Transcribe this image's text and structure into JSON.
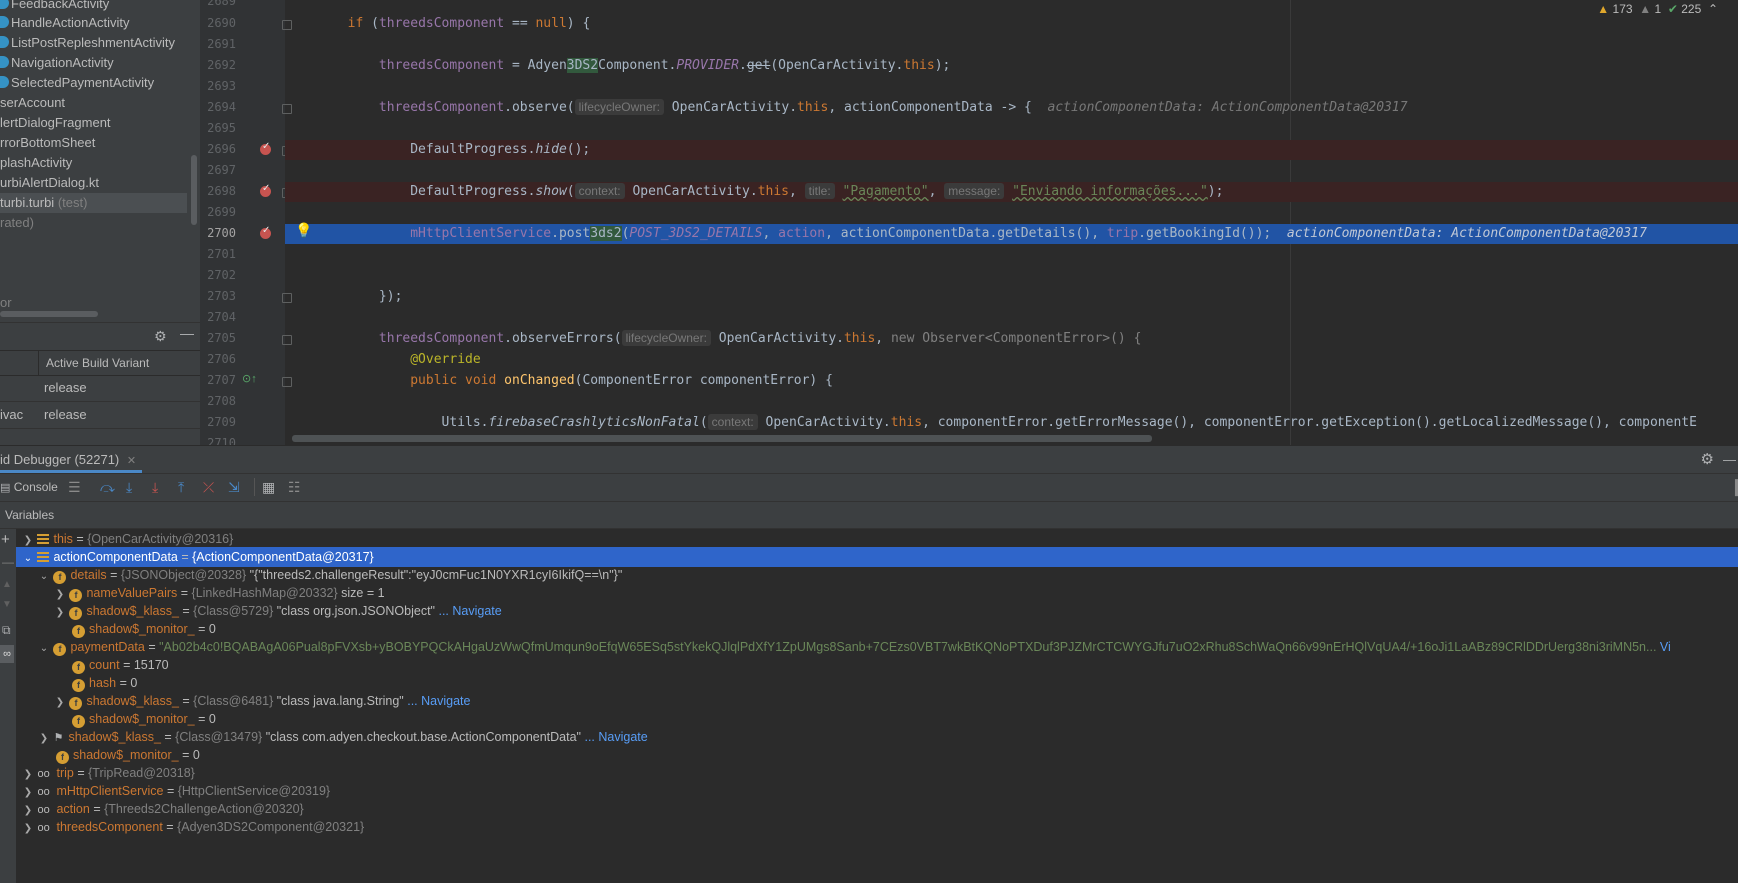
{
  "project_panel": {
    "items": [
      {
        "label": "FeedbackActivity",
        "icon": "class-icon",
        "note": ""
      },
      {
        "label": "HandleActionActivity",
        "icon": "class-icon",
        "note": ""
      },
      {
        "label": "ListPostRepleshmentActivity",
        "icon": "class-icon",
        "note": ""
      },
      {
        "label": "NavigationActivity",
        "icon": "class-icon",
        "note": ""
      },
      {
        "label": "SelectedPaymentActivity",
        "icon": "class-icon",
        "note": ""
      },
      {
        "label": "serAccount",
        "icon": "",
        "note": ""
      },
      {
        "label": "lertDialogFragment",
        "icon": "",
        "note": ""
      },
      {
        "label": "rrorBottomSheet",
        "icon": "",
        "note": ""
      },
      {
        "label": "plashActivity",
        "icon": "",
        "note": ""
      },
      {
        "label": "urbiAlertDialog.kt",
        "icon": "",
        "note": ""
      },
      {
        "label": "turbi.turbi",
        "icon": "",
        "note": "(test)"
      },
      {
        "label": "rated)",
        "icon": "",
        "note": ""
      },
      {
        "label": "or",
        "icon": "",
        "note": ""
      }
    ],
    "build_variants": {
      "header": "Active Build Variant",
      "rows": [
        {
          "module": "",
          "variant": "release"
        },
        {
          "module": "ivac",
          "variant": "release"
        }
      ]
    }
  },
  "editor": {
    "inspections": {
      "warnings": "173",
      "weak_warnings": "1",
      "ok": "225"
    },
    "line_numbers": [
      "2689",
      "2690",
      "2691",
      "2692",
      "2693",
      "2694",
      "2695",
      "2696",
      "2697",
      "2698",
      "2699",
      "2700",
      "2701",
      "2702",
      "2703",
      "2704",
      "2705",
      "2706",
      "2707",
      "2708",
      "2709",
      "2710"
    ],
    "current_line": "2700",
    "code": {
      "l2690": {
        "kw": "if",
        "open": " (",
        "var": "threedsComponent",
        "op": " == ",
        "null": "null",
        "close": ") {"
      },
      "l2692": {
        "var": "threedsComponent",
        "eq": " = ",
        "cls1": "Adyen",
        "ref": "3DS2",
        "cls2": "Component.",
        "provider": "PROVIDER",
        "dot": ".",
        "get": "get",
        "arg": "(OpenCarActivity.",
        "this": "this",
        "end": ");"
      },
      "l2694": {
        "var": "threedsComponent",
        "call": ".observe(",
        "hint": "lifecycleOwner:",
        "arg1": " OpenCarActivity.",
        "this": "this",
        "rest": ", actionComponentData -> {",
        "inline": "actionComponentData: ActionComponentData@20317"
      },
      "l2696": {
        "cls": "DefaultProgress.",
        "method": "hide",
        "end": "();"
      },
      "l2698": {
        "cls": "DefaultProgress.",
        "method": "show",
        "open": "(",
        "hint1": "context:",
        "arg1": " OpenCarActivity.",
        "this": "this",
        "comma1": ", ",
        "hint2": "title:",
        "str1": "\"Pagamento\"",
        "comma2": ", ",
        "hint3": "message:",
        "str2": "\"Enviando informações...\"",
        "end": ");"
      },
      "l2700": {
        "field": "mHttpClientService",
        "call1": ".post",
        "ref": "3ds2",
        "open": "(",
        "const": "POST_3DS2_DETAILS",
        "comma1": ", ",
        "arg1": "action",
        "comma2": ", ",
        "arg2": "actionComponentData.getDetails()",
        "comma3": ", ",
        "arg3": "trip",
        "call2": ".getBookingId());",
        "inline": "actionComponentData: ActionComponentData@20317"
      },
      "l2703": {
        "text": "});"
      },
      "l2705": {
        "var": "threedsComponent",
        "call": ".observeErrors(",
        "hint": "lifecycleOwner:",
        "arg1": " OpenCarActivity.",
        "this": "this",
        "comma": ", ",
        "new": "new",
        "rest": " Observer<ComponentError>() {"
      },
      "l2706": {
        "annotation": "@Override"
      },
      "l2707": {
        "kw1": "public",
        "kw2": " void",
        "method": " onChanged",
        "rest": "(ComponentError componentError) {"
      },
      "l2709": {
        "cls": "Utils.",
        "method": "firebaseCrashlyticsNonFatal",
        "open": "(",
        "hint": "context:",
        "arg1": " OpenCarActivity.",
        "this": "this",
        "rest": ", componentError.getErrorMessage(), componentError.getException().getLocalizedMessage(), componentE"
      }
    }
  },
  "debugger": {
    "tab_title": "id Debugger (52271)",
    "console_label": "Console",
    "variables_label": "Variables",
    "rows": [
      {
        "name": "this",
        "type": "{OpenCarActivity@20316}",
        "value": ""
      },
      {
        "name": "actionComponentData",
        "type": "{ActionComponentData@20317}",
        "value": ""
      },
      {
        "name": "details",
        "type": "{JSONObject@20328}",
        "value": "\"{\"threeds2.challengeResult\":\"eyJ0cmFuc1N0YXR1cyI6IkifQ==\\n\"}\""
      },
      {
        "name": "nameValuePairs",
        "type": "{LinkedHashMap@20332}",
        "value": "size = 1"
      },
      {
        "name": "shadow$_klass_",
        "type": "{Class@5729}",
        "value": "\"class org.json.JSONObject\"",
        "nav": "... Navigate"
      },
      {
        "name": "shadow$_monitor_",
        "type": "",
        "value": "0"
      },
      {
        "name": "paymentData",
        "type": "",
        "value": "\"Ab02b4c0!BQABAgA06Pual8pFVXsb+yBOBYPQCkAHgaUzWwQfmUmqun9oEfqW65ESq5stYkekQJlqlPdXfY1ZpUMgs8Sanb+7CEzs0VBT7wkBtKQNoPTXDuf3PJZMrCTCWYGJfu7uO2xRhu8SchWaQn66v99nErHQlVqUA4/+16oJi1LaABz89CRlDDrUerg38ni3riMN5n...",
        "nav": "Vi"
      },
      {
        "name": "count",
        "type": "",
        "value": "15170"
      },
      {
        "name": "hash",
        "type": "",
        "value": "0"
      },
      {
        "name": "shadow$_klass_",
        "type": "{Class@6481}",
        "value": "\"class java.lang.String\"",
        "nav": "... Navigate"
      },
      {
        "name": "shadow$_monitor_",
        "type": "",
        "value": "0"
      },
      {
        "name": "shadow$_klass_",
        "type": "{Class@13479}",
        "value": "\"class com.adyen.checkout.base.ActionComponentData\"",
        "nav": "... Navigate"
      },
      {
        "name": "shadow$_monitor_",
        "type": "",
        "value": "0"
      },
      {
        "name": "trip",
        "type": "{TripRead@20318}",
        "value": ""
      },
      {
        "name": "mHttpClientService",
        "type": "{HttpClientService@20319}",
        "value": ""
      },
      {
        "name": "action",
        "type": "{Threeds2ChallengeAction@20320}",
        "value": ""
      },
      {
        "name": "threedsComponent",
        "type": "{Adyen3DS2Component@20321}",
        "value": ""
      }
    ]
  },
  "colors": {
    "selection": "#2f65ca",
    "exec_line": "#2154a5",
    "breakpoint": "#c75450",
    "keyword": "#cc7832",
    "string": "#6a8759"
  }
}
